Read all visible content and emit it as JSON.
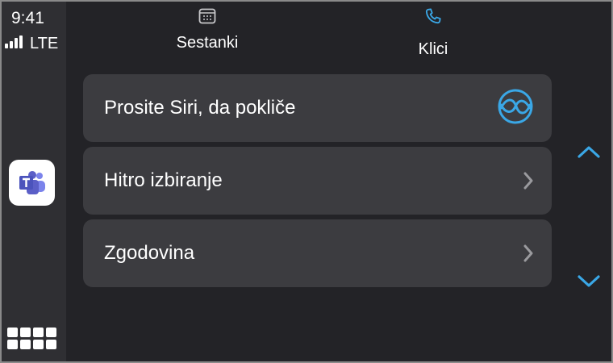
{
  "status": {
    "time": "9:41",
    "network": "LTE"
  },
  "sidebar": {
    "app_icon": "microsoft-teams-icon",
    "launcher_icon": "app-grid-icon"
  },
  "tabs": [
    {
      "label": "Sestanki",
      "icon": "calendar-icon",
      "selected": false
    },
    {
      "label": "Klici",
      "icon": "phone-icon",
      "selected": true
    }
  ],
  "list": [
    {
      "label": "Prosite Siri, da pokliče",
      "icon": "siri-icon"
    },
    {
      "label": "Hitro izbiranje",
      "icon": "chevron-right-icon"
    },
    {
      "label": "Zgodovina",
      "icon": "chevron-right-icon"
    }
  ],
  "scroll": {
    "up_icon": "chevron-up-icon",
    "down_icon": "chevron-down-icon"
  },
  "colors": {
    "background": "#232327",
    "sidebar": "#2f2f33",
    "row": "#3c3c40",
    "accent": "#3aa7e6",
    "text": "#ffffff",
    "teams": "#5b5fc7"
  }
}
